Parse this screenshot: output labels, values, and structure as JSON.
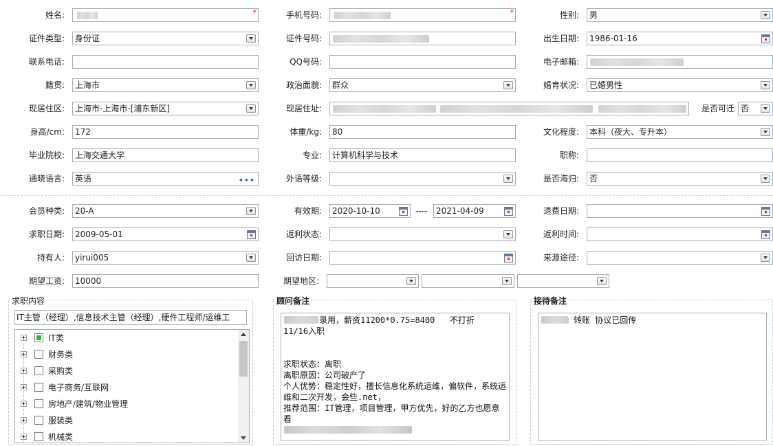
{
  "row1": {
    "name_label": "姓名:",
    "phone_label": "手机号码:",
    "gender_label": "性别:",
    "gender_value": "男",
    "required_mark": "*"
  },
  "row2": {
    "idtype_label": "证件类型:",
    "idtype_value": "身份证",
    "idno_label": "证件号码:",
    "birth_label": "出生日期:",
    "birth_value": "1986-01-16"
  },
  "row3": {
    "tel_label": "联系电话:",
    "qq_label": "QQ号码:",
    "email_label": "电子邮箱:"
  },
  "row4": {
    "native_label": "籍贯:",
    "native_value": "上海市",
    "political_label": "政治面貌:",
    "political_value": "群众",
    "marital_label": "婚育状况:",
    "marital_value": "已婚男性"
  },
  "row5": {
    "residence_label": "现居住区:",
    "residence_value": "上海市-上海市-[浦东新区]",
    "address_label": "现居住址:",
    "reachable_label": "是否可迁",
    "reachable_value": "否"
  },
  "row6": {
    "height_label": "身高/cm:",
    "height_value": "172",
    "weight_label": "体重/kg:",
    "weight_value": "80",
    "edu_label": "文化程度:",
    "edu_value": "本科（夜大、专升本）"
  },
  "row7": {
    "school_label": "毕业院校:",
    "school_value": "上海交通大学",
    "major_label": "专业:",
    "major_value": "计算机科学与技术",
    "title_label": "职称:"
  },
  "row8": {
    "lang_label": "通晓语言:",
    "lang_value": "英语",
    "lang_btn": "•••",
    "foreign_label": "外语等级:",
    "returnee_label": "是否海归:",
    "returnee_value": "否"
  },
  "row9": {
    "member_label": "会员种类:",
    "member_value": "20-A",
    "valid_label": "有效期:",
    "valid_from": "2020-10-10",
    "valid_sep": "----",
    "valid_to": "2021-04-09",
    "refund_label": "退费日期:"
  },
  "row10": {
    "jobdate_label": "求职日期:",
    "jobdate_value": "2009-05-01",
    "rebate_status_label": "返利状态:",
    "rebate_time_label": "返利时间:"
  },
  "row11": {
    "holder_label": "持有人:",
    "holder_value": "yirui005",
    "visit_label": "回访日期:",
    "source_label": "来源途径:"
  },
  "row12": {
    "salary_label": "期望工资:",
    "salary_value": "10000",
    "region_label": "期望地区:"
  },
  "job_panel": {
    "title": "求职内容",
    "summary": "IT主管（经理）,信息技术主管（经理）,硬件工程师/运维工",
    "categories": [
      {
        "label": "IT类",
        "checked": true
      },
      {
        "label": "财务类",
        "checked": false
      },
      {
        "label": "采购类",
        "checked": false
      },
      {
        "label": "电子商务/互联网",
        "checked": false
      },
      {
        "label": "房地产/建筑/物业管理",
        "checked": false
      },
      {
        "label": "服装类",
        "checked": false
      },
      {
        "label": "机械类",
        "checked": false
      }
    ]
  },
  "advisor_panel": {
    "title": "顾问备注",
    "note_line1": "录用，薪资11200*0.75=8400   不打折",
    "note_line2": "11/16入职",
    "note_body": "求职状态：离职\n离职原因：公司破产了\n个人优势：稳定性好，擅长信息化系统运维，偏软件，系统运维和二次开发，会些.net，\n推荐范围：IT管理，项目管理，甲方优先，好的乙方也愿意看"
  },
  "reception_panel": {
    "title": "接待备注",
    "note": "转账 协议已回传"
  },
  "colors": {
    "border": "#a5acb5",
    "required": "#ee0033",
    "check_on": "#2fb52f"
  }
}
